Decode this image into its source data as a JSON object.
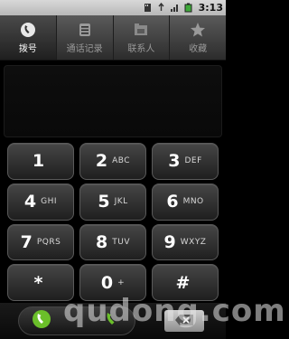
{
  "status_bar": {
    "time": "3:13"
  },
  "tabs": [
    {
      "label": "拨号",
      "icon": "phone-icon",
      "active": true
    },
    {
      "label": "通话记录",
      "icon": "call-log-icon",
      "active": false
    },
    {
      "label": "联系人",
      "icon": "contacts-icon",
      "active": false
    },
    {
      "label": "收藏",
      "icon": "star-icon",
      "active": false
    }
  ],
  "display": {
    "number": ""
  },
  "keypad": [
    {
      "digit": "1",
      "letters": ""
    },
    {
      "digit": "2",
      "letters": "ABC"
    },
    {
      "digit": "3",
      "letters": "DEF"
    },
    {
      "digit": "4",
      "letters": "GHI"
    },
    {
      "digit": "5",
      "letters": "JKL"
    },
    {
      "digit": "6",
      "letters": "MNO"
    },
    {
      "digit": "7",
      "letters": "PQRS"
    },
    {
      "digit": "8",
      "letters": "TUV"
    },
    {
      "digit": "9",
      "letters": "WXYZ"
    },
    {
      "digit": "*",
      "letters": ""
    },
    {
      "digit": "0",
      "letters": "+"
    },
    {
      "digit": "#",
      "letters": ""
    }
  ],
  "watermark": "qudong.com",
  "colors": {
    "call_green": "#6bbf2a",
    "accent_bg": "#000000"
  }
}
